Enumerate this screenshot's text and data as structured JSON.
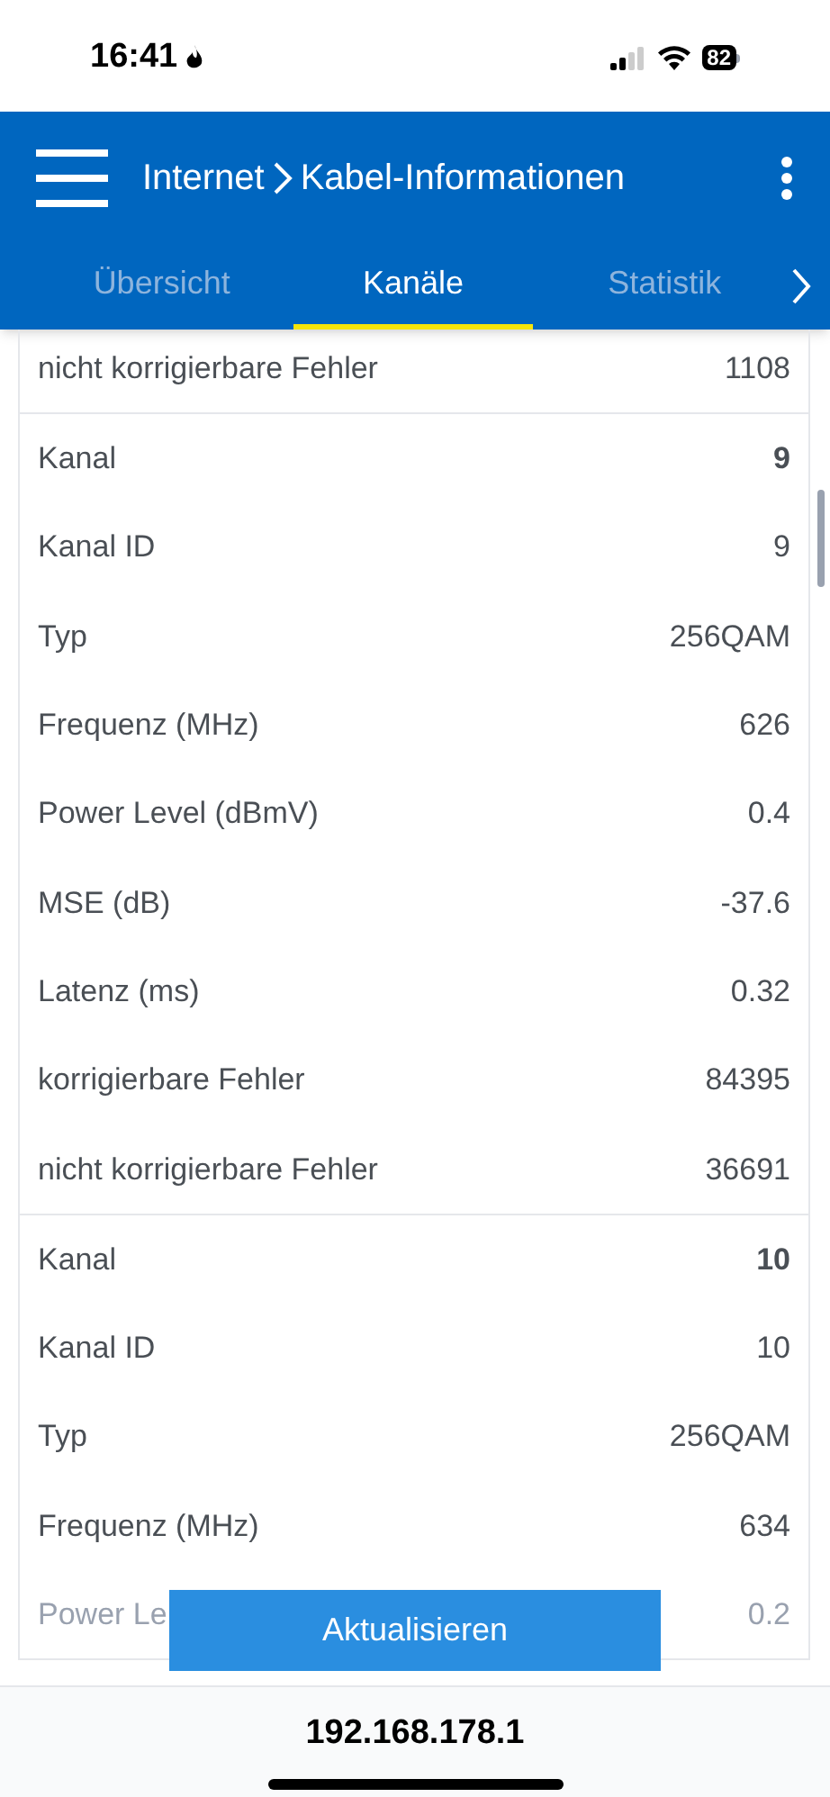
{
  "status_bar": {
    "time": "16:41",
    "battery": "82"
  },
  "header": {
    "title": "Internet",
    "subtitle": "Kabel-Informationen"
  },
  "tabs": [
    {
      "label": "Übersicht",
      "selected": false
    },
    {
      "label": "Kanäle",
      "selected": true
    },
    {
      "label": "Statistik",
      "selected": false
    }
  ],
  "groups": [
    {
      "rows": [
        {
          "kind": "plain",
          "label": "nicht korrigierbare Fehler",
          "value": "1108",
          "faded": false
        }
      ]
    },
    {
      "rows": [
        {
          "kind": "header",
          "label": "Kanal",
          "value": "9",
          "faded": false
        },
        {
          "kind": "plain",
          "label": "Kanal ID",
          "value": "9",
          "faded": false
        },
        {
          "kind": "plain",
          "label": "Typ",
          "value": "256QAM",
          "faded": false
        },
        {
          "kind": "plain",
          "label": "Frequenz (MHz)",
          "value": "626",
          "faded": false
        },
        {
          "kind": "plain",
          "label": "Power Level (dBmV)",
          "value": "0.4",
          "faded": false
        },
        {
          "kind": "plain",
          "label": "MSE (dB)",
          "value": "-37.6",
          "faded": false
        },
        {
          "kind": "plain",
          "label": "Latenz (ms)",
          "value": "0.32",
          "faded": false
        },
        {
          "kind": "plain",
          "label": "korrigierbare Fehler",
          "value": "84395",
          "faded": false
        },
        {
          "kind": "plain",
          "label": "nicht korrigierbare Fehler",
          "value": "36691",
          "faded": false
        }
      ]
    },
    {
      "rows": [
        {
          "kind": "header",
          "label": "Kanal",
          "value": "10",
          "faded": false
        },
        {
          "kind": "plain",
          "label": "Kanal ID",
          "value": "10",
          "faded": false
        },
        {
          "kind": "plain",
          "label": "Typ",
          "value": "256QAM",
          "faded": false
        },
        {
          "kind": "plain",
          "label": "Frequenz (MHz)",
          "value": "634",
          "faded": false
        },
        {
          "kind": "plain",
          "label": "Power Le",
          "value": "0.2",
          "faded": true
        }
      ]
    }
  ],
  "button": "Aktualisieren",
  "url": "192.168.178.1"
}
